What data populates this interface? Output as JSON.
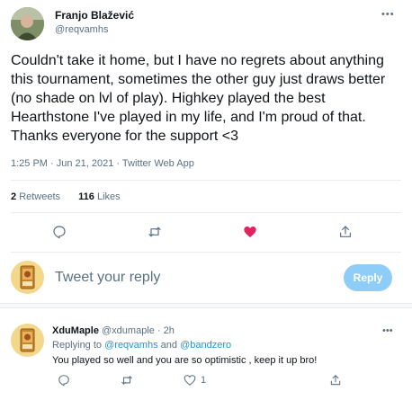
{
  "tweet": {
    "author_name": "Franjo Blažević",
    "author_handle": "@reqvamhs",
    "text": "Couldn't take it home, but I have no regrets about anything this tournament, sometimes the other guy just draws better (no shade on lvl of play). Highkey played the best Hearthstone I've played in my life, and I'm proud of that. Thanks everyone for the support <3",
    "meta": "1:25 PM · Jun 21, 2021 · Twitter Web App",
    "retweets_count": "2",
    "retweets_label": "Retweets",
    "likes_count": "116",
    "likes_label": "Likes",
    "liked": true,
    "like_color": "#e0245e"
  },
  "composer": {
    "placeholder": "Tweet your reply",
    "reply_button": "Reply",
    "reply_button_color": "#8ecdf7"
  },
  "reply": {
    "author_name": "XduMaple",
    "author_handle": "@xdumaple",
    "time": "· 2h",
    "replying_prefix": "Replying to",
    "mention_1": "@reqvamhs",
    "and_word": "and",
    "mention_2": "@bandzero",
    "text": "You played so well and you are so optimistic  , keep it up bro!",
    "like_count": "1"
  },
  "icons": [
    "reply-icon",
    "retweet-icon",
    "heart-icon",
    "share-icon",
    "more-icon"
  ],
  "colors": {
    "text": "#0f1419",
    "secondary": "#5b7083",
    "link": "#1b95e0",
    "divider": "#e6ecf0"
  }
}
